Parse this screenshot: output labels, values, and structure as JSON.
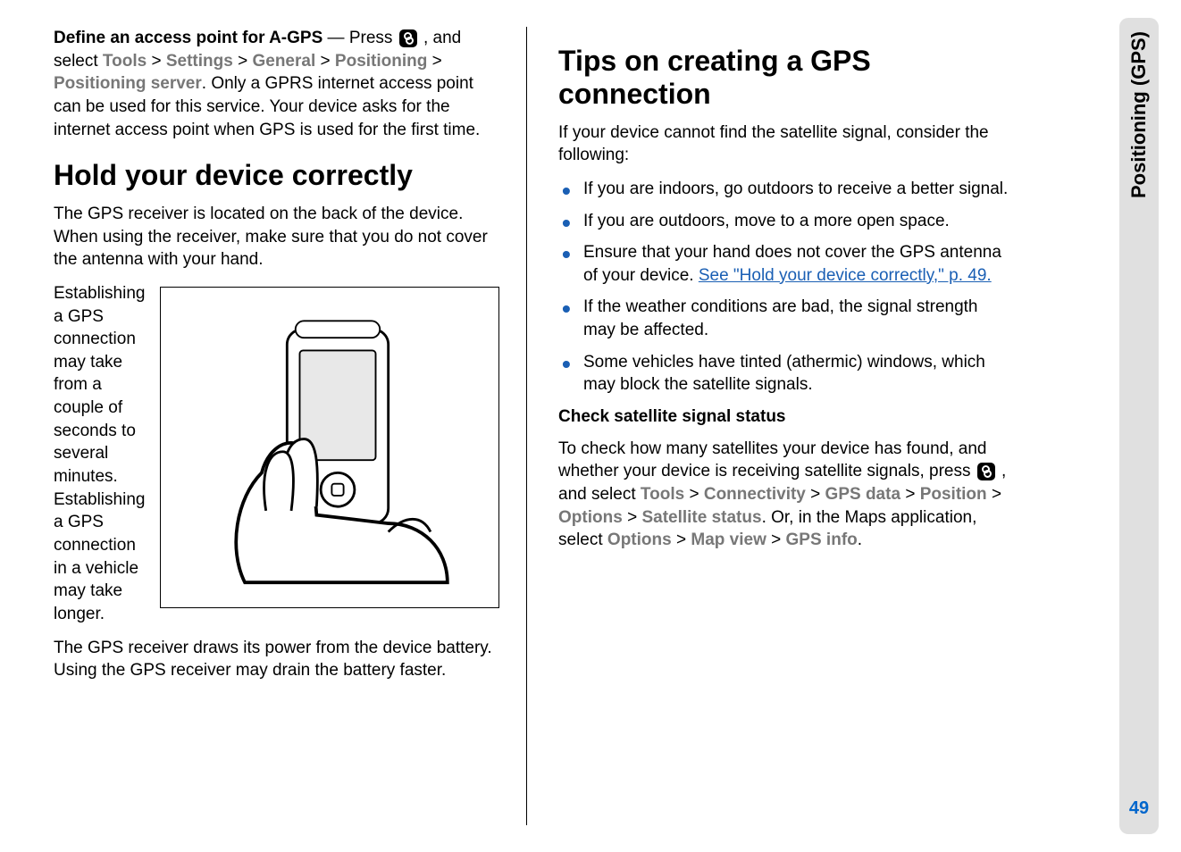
{
  "sideTab": {
    "label": "Positioning (GPS)",
    "pageNumber": "49"
  },
  "leftColumn": {
    "p1": {
      "boldIntro": "Define an access point for A-GPS",
      "dash": " —  Press ",
      "afterIcon": " , and select ",
      "nav": {
        "i1": "Tools",
        "i2": "Settings",
        "i3": "General",
        "i4": "Positioning",
        "i5": "Positioning server"
      },
      "tail": ". Only a GPRS internet access point can be used for this service. Your device asks for the internet access point when GPS is used for the first time."
    },
    "h1": "Hold your device correctly",
    "p2": "The GPS receiver is located on the back of the device. When using the receiver, make sure that you do not cover the antenna with your hand.",
    "p3": "Establishing a GPS connection may take from a couple of seconds to several minutes. Establishing a GPS connection in a vehicle may take longer.",
    "p4": "The GPS receiver draws its power from the device battery. Using the GPS receiver may drain the battery faster."
  },
  "rightColumn": {
    "h1": "Tips on creating a GPS connection",
    "intro": "If your device cannot find the satellite signal, consider the following:",
    "tips": {
      "t1": "If you are indoors, go outdoors to receive a better signal.",
      "t2": "If you are outdoors, move to a more open space.",
      "t3a": "Ensure that your hand does not cover the GPS antenna of your device. ",
      "t3link": "See \"Hold your device correctly,\" p. 49.",
      "t4": "If the weather conditions are bad, the signal strength may be affected.",
      "t5": "Some vehicles have tinted (athermic) windows, which may block the satellite signals."
    },
    "subhead": "Check satellite signal status",
    "p1a": "To check how many satellites your device has found, and whether your device is receiving satellite signals, press ",
    "p1b": " , and select ",
    "navA": {
      "i1": "Tools",
      "i2": "Connectivity",
      "i3": "GPS data",
      "i4": "Position",
      "i5": "Options",
      "i6": "Satellite status"
    },
    "p1c": ". Or, in the Maps application, select ",
    "navB": {
      "i1": "Options",
      "i2": "Map view",
      "i3": "GPS info"
    },
    "p1d": "."
  }
}
